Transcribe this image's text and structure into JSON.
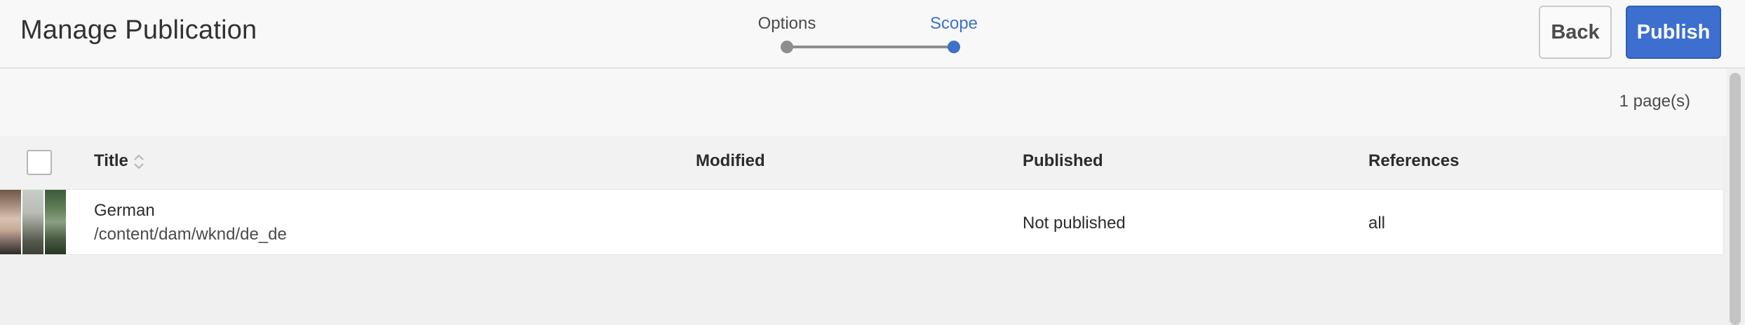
{
  "header": {
    "title": "Manage Publication",
    "wizard": {
      "steps": [
        {
          "label": "Options",
          "state": "completed"
        },
        {
          "label": "Scope",
          "state": "current"
        }
      ]
    },
    "buttons": {
      "back_label": "Back",
      "publish_label": "Publish"
    }
  },
  "toolbar": {
    "page_count": "1 page(s)"
  },
  "table": {
    "columns": [
      {
        "label": "Title",
        "sortable": true
      },
      {
        "label": "Modified"
      },
      {
        "label": "Published"
      },
      {
        "label": "References"
      }
    ],
    "rows": [
      {
        "title": "German",
        "path": "/content/dam/wknd/de_de",
        "modified": "",
        "published": "Not published",
        "references": "all"
      }
    ]
  },
  "colors": {
    "accent": "#3d6fcf",
    "current_step": "#3e72c8",
    "completed_step": "#8e8e8e"
  },
  "icons": {
    "sort": "sort-icon",
    "checkbox": "checkbox-icon"
  }
}
